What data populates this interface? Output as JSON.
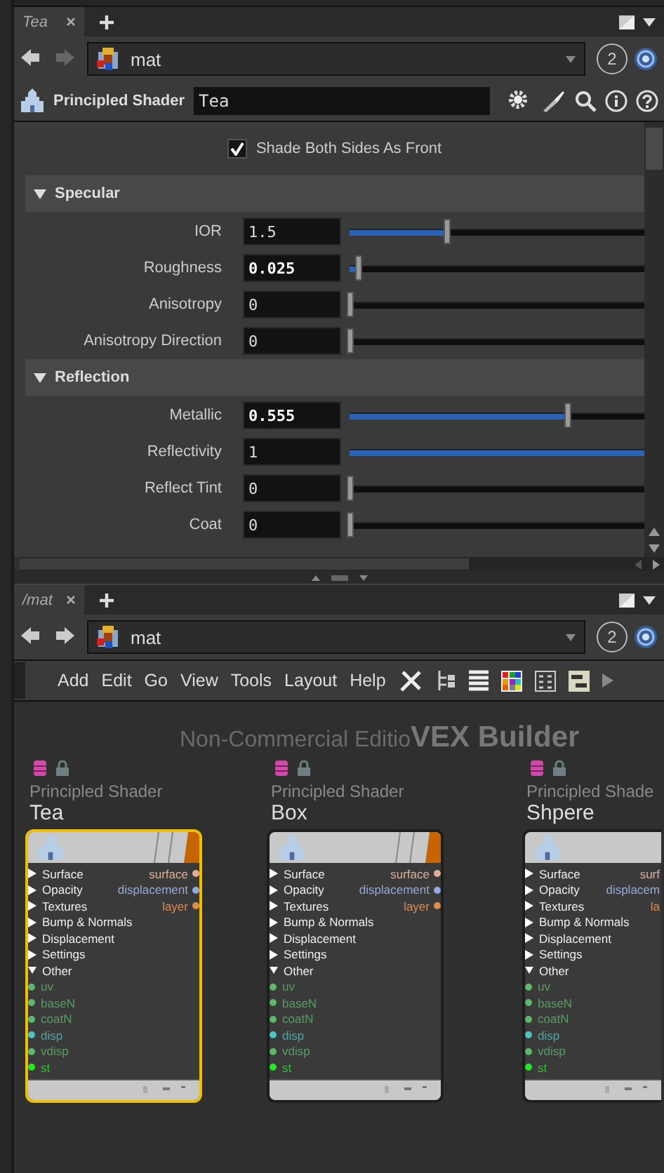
{
  "top_pane": {
    "tab": {
      "label": "Tea",
      "selected": true
    },
    "path": "mat",
    "badge": "2",
    "node_type": "Principled Shader",
    "node_name": "Tea",
    "toggle": {
      "label": "Shade Both Sides As Front",
      "checked": true
    },
    "sections": [
      {
        "title": "Specular",
        "expanded": true,
        "params": [
          {
            "label": "IOR",
            "value": "1.5",
            "changed": false,
            "level": 0.33
          },
          {
            "label": "Roughness",
            "value": "0.025",
            "changed": true,
            "level": 0.03
          },
          {
            "label": "Anisotropy",
            "value": "0",
            "changed": false,
            "level": 0
          },
          {
            "label": "Anisotropy Direction",
            "value": "0",
            "changed": false,
            "level": 0
          }
        ]
      },
      {
        "title": "Reflection",
        "expanded": true,
        "params": [
          {
            "label": "Metallic",
            "value": "0.555",
            "changed": true,
            "level": 0.74
          },
          {
            "label": "Reflectivity",
            "value": "1",
            "changed": false,
            "level": 1
          },
          {
            "label": "Reflect Tint",
            "value": "0",
            "changed": false,
            "level": 0
          },
          {
            "label": "Coat",
            "value": "0",
            "changed": false,
            "level": 0
          }
        ]
      }
    ]
  },
  "bottom_pane": {
    "tab": {
      "label": "/mat",
      "selected": true
    },
    "path": "mat",
    "badge": "2",
    "menu": [
      "Add",
      "Edit",
      "Go",
      "View",
      "Tools",
      "Layout",
      "Help"
    ],
    "watermark": "Non-Commercial Editio",
    "context": "VEX Builder",
    "nodes": [
      {
        "type": "Principled Shader",
        "name": "Tea",
        "selected": true,
        "clipped": false,
        "inputs": [
          {
            "label": "Surface",
            "kind": "folder",
            "expanded": false
          },
          {
            "label": "Opacity",
            "kind": "folder",
            "expanded": false
          },
          {
            "label": "Textures",
            "kind": "folder",
            "expanded": false
          },
          {
            "label": "Bump & Normals",
            "kind": "folder",
            "expanded": false
          },
          {
            "label": "Displacement",
            "kind": "folder",
            "expanded": false
          },
          {
            "label": "Settings",
            "kind": "folder",
            "expanded": false
          },
          {
            "label": "Other",
            "kind": "folder",
            "expanded": true
          },
          {
            "label": "uv",
            "kind": "port",
            "color": "#5cb86a"
          },
          {
            "label": "baseN",
            "kind": "port",
            "color": "#5cb86a"
          },
          {
            "label": "coatN",
            "kind": "port",
            "color": "#5cb86a"
          },
          {
            "label": "disp",
            "kind": "port",
            "color": "#4cc4c4"
          },
          {
            "label": "vdisp",
            "kind": "port",
            "color": "#5cb86a"
          },
          {
            "label": "st",
            "kind": "port",
            "color": "#22e822"
          }
        ],
        "outputs": [
          {
            "label": "surface",
            "color": "#e0ae96"
          },
          {
            "label": "displacement",
            "color": "#93a9e0"
          },
          {
            "label": "layer",
            "color": "#e08a4c"
          }
        ]
      },
      {
        "type": "Principled Shader",
        "name": "Box",
        "selected": false,
        "clipped": false,
        "inputs": [
          {
            "label": "Surface",
            "kind": "folder",
            "expanded": false
          },
          {
            "label": "Opacity",
            "kind": "folder",
            "expanded": false
          },
          {
            "label": "Textures",
            "kind": "folder",
            "expanded": false
          },
          {
            "label": "Bump & Normals",
            "kind": "folder",
            "expanded": false
          },
          {
            "label": "Displacement",
            "kind": "folder",
            "expanded": false
          },
          {
            "label": "Settings",
            "kind": "folder",
            "expanded": false
          },
          {
            "label": "Other",
            "kind": "folder",
            "expanded": true
          },
          {
            "label": "uv",
            "kind": "port",
            "color": "#5cb86a"
          },
          {
            "label": "baseN",
            "kind": "port",
            "color": "#5cb86a"
          },
          {
            "label": "coatN",
            "kind": "port",
            "color": "#5cb86a"
          },
          {
            "label": "disp",
            "kind": "port",
            "color": "#4cc4c4"
          },
          {
            "label": "vdisp",
            "kind": "port",
            "color": "#5cb86a"
          },
          {
            "label": "st",
            "kind": "port",
            "color": "#22e822"
          }
        ],
        "outputs": [
          {
            "label": "surface",
            "color": "#e0ae96"
          },
          {
            "label": "displacement",
            "color": "#93a9e0"
          },
          {
            "label": "layer",
            "color": "#e08a4c"
          }
        ]
      },
      {
        "type": "Principled Shade",
        "name": "Shpere",
        "selected": false,
        "clipped": true,
        "inputs": [
          {
            "label": "Surface",
            "kind": "folder",
            "expanded": false
          },
          {
            "label": "Opacity",
            "kind": "folder",
            "expanded": false
          },
          {
            "label": "Textures",
            "kind": "folder",
            "expanded": false
          },
          {
            "label": "Bump & Normals",
            "kind": "folder",
            "expanded": false
          },
          {
            "label": "Displacement",
            "kind": "folder",
            "expanded": false
          },
          {
            "label": "Settings",
            "kind": "folder",
            "expanded": false
          },
          {
            "label": "Other",
            "kind": "folder",
            "expanded": true
          },
          {
            "label": "uv",
            "kind": "port",
            "color": "#5cb86a"
          },
          {
            "label": "baseN",
            "kind": "port",
            "color": "#5cb86a"
          },
          {
            "label": "coatN",
            "kind": "port",
            "color": "#5cb86a"
          },
          {
            "label": "disp",
            "kind": "port",
            "color": "#4cc4c4"
          },
          {
            "label": "vdisp",
            "kind": "port",
            "color": "#5cb86a"
          },
          {
            "label": "st",
            "kind": "port",
            "color": "#22e822"
          }
        ],
        "outputs": [
          {
            "label": "surf",
            "color": "#e0ae96"
          },
          {
            "label": "displacem",
            "color": "#93a9e0"
          },
          {
            "label": "la",
            "color": "#e08a4c"
          }
        ]
      }
    ]
  }
}
